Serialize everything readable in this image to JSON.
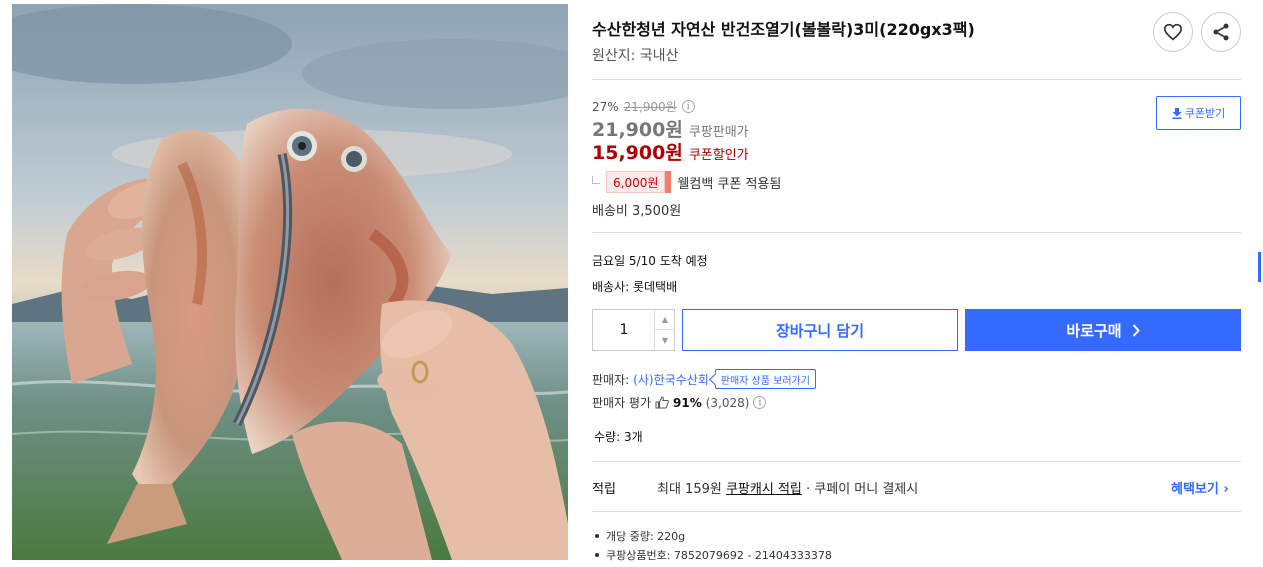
{
  "product": {
    "title": "수산한청년 자연산 반건조열기(볼볼락)3미(220gx3팩)",
    "origin": "원산지: 국내산"
  },
  "icons": {
    "wishlist": "heart-icon",
    "share": "share-icon",
    "download": "download-icon",
    "info": "info-icon",
    "thumb": "thumbs-up-icon"
  },
  "pricing": {
    "discount_rate": "27%",
    "original_price": "21,900원",
    "sale_price": "21,900원",
    "sale_label": "쿠팡판매가",
    "coupon_price": "15,900원",
    "coupon_label": "쿠폰할인가",
    "coupon_button": "쿠폰받기",
    "welcome_amount": "6,000원",
    "welcome_text": "웰컴백 쿠폰 적용됨",
    "shipping_fee": "배송비 3,500원"
  },
  "delivery": {
    "arrival": "금요일 5/10 도착 예정",
    "carrier": "배송사: 롯데택배"
  },
  "purchase": {
    "quantity": "1",
    "cart_button": "장바구니 담기",
    "buy_button": "바로구매"
  },
  "seller": {
    "label": "판매자:",
    "name": "(사)한국수산회",
    "tooltip": "판매자 상품 보러가기",
    "rating_label": "판매자 평가",
    "rating_pct": "91%",
    "rating_count": "(3,028)"
  },
  "quantity_info": "수량: 3개",
  "reward": {
    "label": "적립",
    "text_prefix": "최대 159원 ",
    "text_link": "쿠팡캐시 적립",
    "text_suffix": " · 쿠페이 머니 결제시",
    "benefit_link": "혜택보기"
  },
  "specs": [
    "개당 중량: 220g",
    "쿠팡상품번호: 7852079692 - 21404333378"
  ],
  "colors": {
    "accent": "#346aff",
    "coupon_red": "#ae0000"
  }
}
